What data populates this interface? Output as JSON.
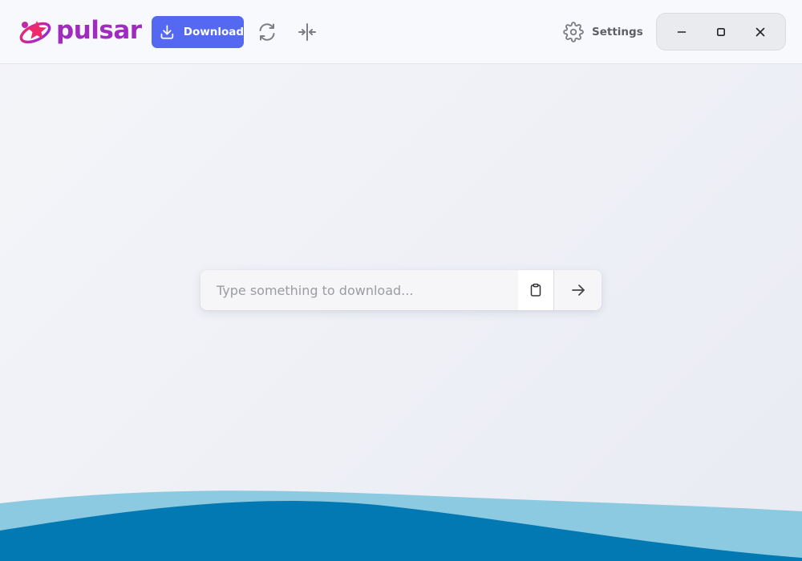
{
  "app": {
    "name": "pulsar"
  },
  "toolbar": {
    "download_label": "Download",
    "sync_icon": "sync-icon",
    "compress_icon": "collapse-horizontal-icon",
    "settings_label": "Settings",
    "settings_icon": "gear-icon"
  },
  "window_controls": {
    "minimize_icon": "minimize-icon",
    "maximize_icon": "maximize-icon",
    "close_icon": "close-icon"
  },
  "search": {
    "placeholder": "Type something to download...",
    "value": "",
    "paste_icon": "clipboard-icon",
    "submit_icon": "arrow-right-icon"
  },
  "colors": {
    "accent": "#5468f2",
    "logo_gradient_start": "#ee2a6b",
    "logo_gradient_end": "#8a2be2",
    "wave_light": "#8ccae2",
    "wave_dark": "#0379b3"
  }
}
